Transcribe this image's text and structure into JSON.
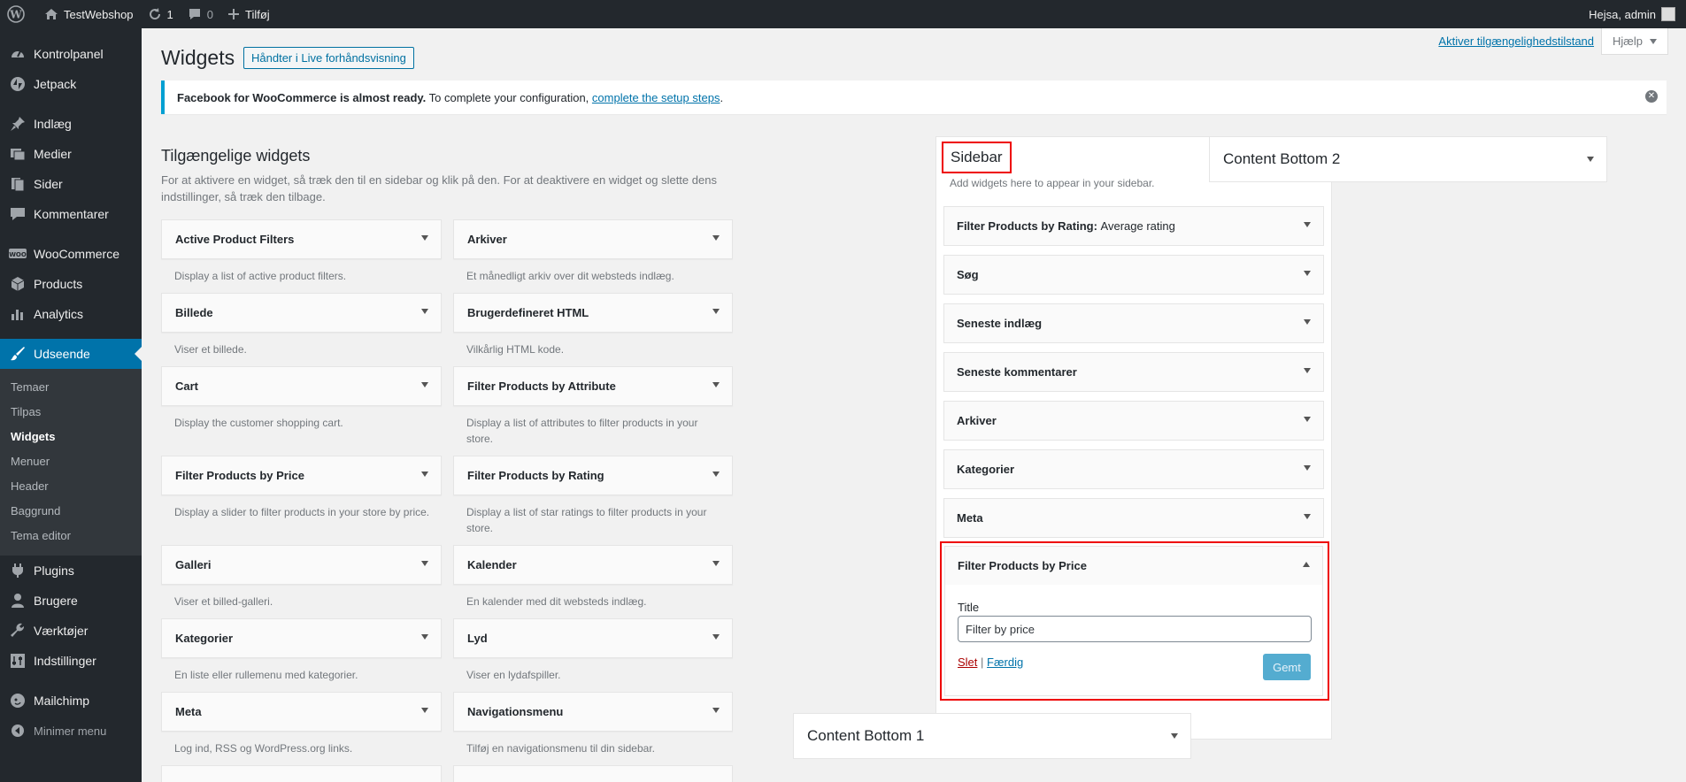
{
  "admin_bar": {
    "site_name": "TestWebshop",
    "updates": "1",
    "comments": "0",
    "new_label": "Tilføj",
    "greeting": "Hejsa, admin"
  },
  "menu": {
    "items_top": [
      {
        "label": "Kontrolpanel",
        "icon": "dashboard-icon"
      },
      {
        "label": "Jetpack",
        "icon": "jetpack-icon"
      }
    ],
    "items_content": [
      {
        "label": "Indlæg",
        "icon": "pin-icon"
      },
      {
        "label": "Medier",
        "icon": "media-icon"
      },
      {
        "label": "Sider",
        "icon": "page-icon"
      },
      {
        "label": "Kommentarer",
        "icon": "comment-icon"
      }
    ],
    "items_shop": [
      {
        "label": "WooCommerce",
        "icon": "woo-icon"
      },
      {
        "label": "Products",
        "icon": "box-icon"
      },
      {
        "label": "Analytics",
        "icon": "chart-bar-icon"
      }
    ],
    "current": {
      "label": "Udseende",
      "icon": "brush-icon"
    },
    "submenu": [
      "Temaer",
      "Tilpas",
      "Widgets",
      "Menuer",
      "Header",
      "Baggrund",
      "Tema editor"
    ],
    "items_bottom": [
      {
        "label": "Plugins",
        "icon": "plug-icon"
      },
      {
        "label": "Brugere",
        "icon": "user-icon"
      },
      {
        "label": "Værktøjer",
        "icon": "wrench-icon"
      },
      {
        "label": "Indstillinger",
        "icon": "settings-icon"
      }
    ],
    "mailchimp": "Mailchimp",
    "collapse": "Minimer menu"
  },
  "header": {
    "title": "Widgets",
    "live_preview": "Håndter i Live forhåndsvisning",
    "accessibility_link": "Aktiver tilgængelighedstilstand",
    "help": "Hjælp"
  },
  "notice": {
    "bold": "Facebook for WooCommerce is almost ready.",
    "text": " To complete your configuration, ",
    "link": "complete the setup steps",
    "end": "."
  },
  "available": {
    "heading": "Tilgængelige widgets",
    "description": "For at aktivere en widget, så træk den til en sidebar og klik på den. For at deaktivere en widget og slette dens indstillinger, så træk den tilbage.",
    "left": [
      {
        "title": "Active Product Filters",
        "desc": "Display a list of active product filters."
      },
      {
        "title": "Billede",
        "desc": "Viser et billede."
      },
      {
        "title": "Cart",
        "desc": "Display the customer shopping cart."
      },
      {
        "title": "Filter Products by Price",
        "desc": "Display a slider to filter products in your store by price."
      },
      {
        "title": "Galleri",
        "desc": "Viser et billed-galleri."
      },
      {
        "title": "Kategorier",
        "desc": "En liste eller rullemenu med kategorier."
      },
      {
        "title": "Meta",
        "desc": "Log ind, RSS og WordPress.org links."
      }
    ],
    "right": [
      {
        "title": "Arkiver",
        "desc": "Et månedligt arkiv over dit websteds indlæg."
      },
      {
        "title": "Brugerdefineret HTML",
        "desc": "Vilkårlig HTML kode."
      },
      {
        "title": "Filter Products by Attribute",
        "desc": "Display a list of attributes to filter products in your store."
      },
      {
        "title": "Filter Products by Rating",
        "desc": "Display a list of star ratings to filter products in your store."
      },
      {
        "title": "Kalender",
        "desc": "En kalender med dit websteds indlæg."
      },
      {
        "title": "Lyd",
        "desc": "Viser en lydafspiller."
      },
      {
        "title": "Navigationsmenu",
        "desc": "Tilføj en navigationsmenu til din sidebar."
      }
    ]
  },
  "sidebar": {
    "title": "Sidebar",
    "description": "Add widgets here to appear in your sidebar.",
    "widgets": [
      {
        "title": "Filter Products by Rating:",
        "sub": "Average rating"
      },
      {
        "title": "Søg",
        "sub": ""
      },
      {
        "title": "Seneste indlæg",
        "sub": ""
      },
      {
        "title": "Seneste kommentarer",
        "sub": ""
      },
      {
        "title": "Arkiver",
        "sub": ""
      },
      {
        "title": "Kategorier",
        "sub": ""
      },
      {
        "title": "Meta",
        "sub": ""
      }
    ],
    "open_widget": {
      "title": "Filter Products by Price",
      "field_label": "Title",
      "field_value": "Filter by price",
      "delete": "Slet",
      "separator": "|",
      "done": "Færdig",
      "save": "Gemt"
    }
  },
  "areas": {
    "content_bottom_1": "Content Bottom 1",
    "content_bottom_2": "Content Bottom 2"
  }
}
